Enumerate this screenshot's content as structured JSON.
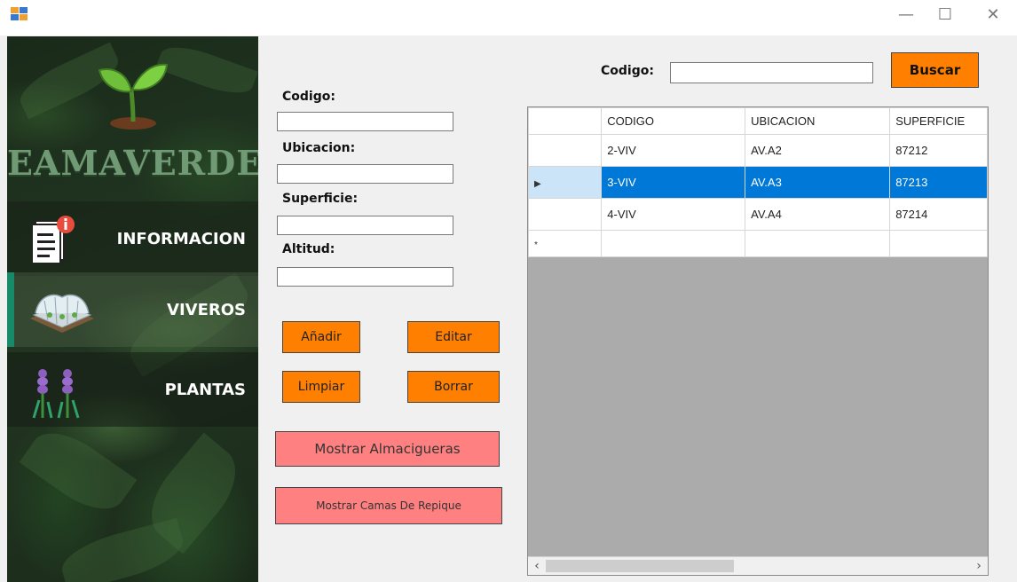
{
  "window": {
    "minimize": "—",
    "maximize": "☐",
    "close": "✕"
  },
  "brand": {
    "name": "EAMAVERDE"
  },
  "sidebar": {
    "items": [
      {
        "label": "INFORMACION",
        "icon": "document-info-icon"
      },
      {
        "label": "VIVEROS",
        "icon": "greenhouse-icon",
        "active": true
      },
      {
        "label": "PLANTAS",
        "icon": "lavender-plant-icon"
      }
    ]
  },
  "form": {
    "codigo_label": "Codigo:",
    "codigo_value": "",
    "ubicacion_label": "Ubicacion:",
    "ubicacion_value": "",
    "superficie_label": "Superficie:",
    "superficie_value": "",
    "altitud_label": "Altitud:",
    "altitud_value": ""
  },
  "buttons": {
    "add": "Añadir",
    "edit": "Editar",
    "clear": "Limpiar",
    "delete": "Borrar",
    "show_seedbeds": "Mostrar Almacigueras",
    "show_transplant_beds": "Mostrar Camas De Repique"
  },
  "search": {
    "label": "Codigo:",
    "value": "",
    "button": "Buscar"
  },
  "grid": {
    "columns": [
      "CODIGO",
      "UBICACION",
      "SUPERFICIE"
    ],
    "rows": [
      [
        "2-VIV",
        "AV.A2",
        "87212"
      ],
      [
        "3-VIV",
        "AV.A3",
        "87213"
      ],
      [
        "4-VIV",
        "AV.A4",
        "87214"
      ]
    ],
    "selected_row": 1,
    "current_row_marker": "▶",
    "new_row_marker": "*"
  },
  "colors": {
    "orange_button": "#ff8000",
    "pink_button": "#ff8080",
    "selection": "#0078d7",
    "active_nav_accent": "#178a6a"
  }
}
